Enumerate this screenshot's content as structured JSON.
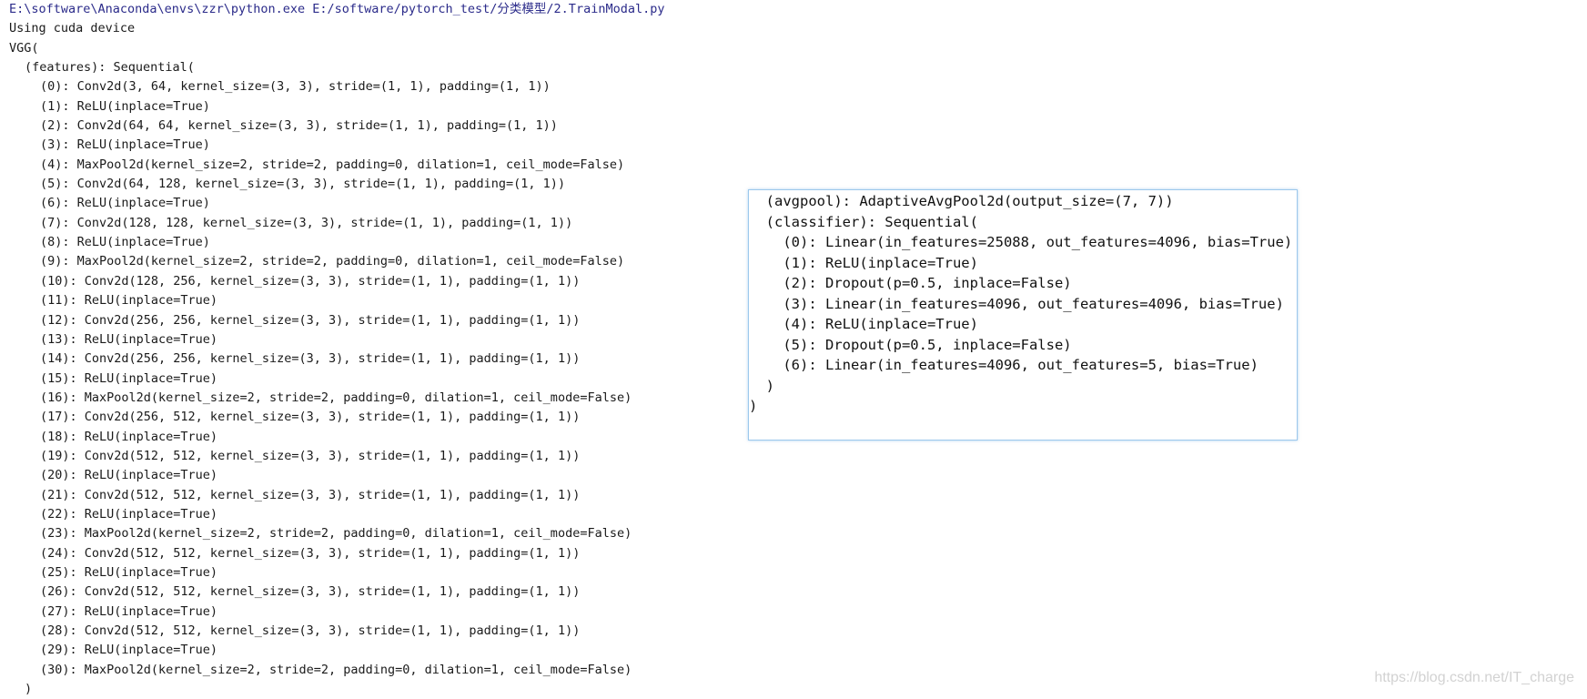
{
  "console": {
    "command": "E:\\software\\Anaconda\\envs\\zzr\\python.exe E:/software/pytorch_test/分类模型/2.TrainModal.py",
    "device_line": "Using cuda device",
    "model_open": "VGG(",
    "features_header": "(features): Sequential(",
    "layers": [
      "(0): Conv2d(3, 64, kernel_size=(3, 3), stride=(1, 1), padding=(1, 1))",
      "(1): ReLU(inplace=True)",
      "(2): Conv2d(64, 64, kernel_size=(3, 3), stride=(1, 1), padding=(1, 1))",
      "(3): ReLU(inplace=True)",
      "(4): MaxPool2d(kernel_size=2, stride=2, padding=0, dilation=1, ceil_mode=False)",
      "(5): Conv2d(64, 128, kernel_size=(3, 3), stride=(1, 1), padding=(1, 1))",
      "(6): ReLU(inplace=True)",
      "(7): Conv2d(128, 128, kernel_size=(3, 3), stride=(1, 1), padding=(1, 1))",
      "(8): ReLU(inplace=True)",
      "(9): MaxPool2d(kernel_size=2, stride=2, padding=0, dilation=1, ceil_mode=False)",
      "(10): Conv2d(128, 256, kernel_size=(3, 3), stride=(1, 1), padding=(1, 1))",
      "(11): ReLU(inplace=True)",
      "(12): Conv2d(256, 256, kernel_size=(3, 3), stride=(1, 1), padding=(1, 1))",
      "(13): ReLU(inplace=True)",
      "(14): Conv2d(256, 256, kernel_size=(3, 3), stride=(1, 1), padding=(1, 1))",
      "(15): ReLU(inplace=True)",
      "(16): MaxPool2d(kernel_size=2, stride=2, padding=0, dilation=1, ceil_mode=False)",
      "(17): Conv2d(256, 512, kernel_size=(3, 3), stride=(1, 1), padding=(1, 1))",
      "(18): ReLU(inplace=True)",
      "(19): Conv2d(512, 512, kernel_size=(3, 3), stride=(1, 1), padding=(1, 1))",
      "(20): ReLU(inplace=True)",
      "(21): Conv2d(512, 512, kernel_size=(3, 3), stride=(1, 1), padding=(1, 1))",
      "(22): ReLU(inplace=True)",
      "(23): MaxPool2d(kernel_size=2, stride=2, padding=0, dilation=1, ceil_mode=False)",
      "(24): Conv2d(512, 512, kernel_size=(3, 3), stride=(1, 1), padding=(1, 1))",
      "(25): ReLU(inplace=True)",
      "(26): Conv2d(512, 512, kernel_size=(3, 3), stride=(1, 1), padding=(1, 1))",
      "(27): ReLU(inplace=True)",
      "(28): Conv2d(512, 512, kernel_size=(3, 3), stride=(1, 1), padding=(1, 1))",
      "(29): ReLU(inplace=True)",
      "(30): MaxPool2d(kernel_size=2, stride=2, padding=0, dilation=1, ceil_mode=False)"
    ],
    "features_close": ")"
  },
  "popup": {
    "lines": [
      "  (avgpool): AdaptiveAvgPool2d(output_size=(7, 7))",
      "  (classifier): Sequential(",
      "    (0): Linear(in_features=25088, out_features=4096, bias=True)",
      "    (1): ReLU(inplace=True)",
      "    (2): Dropout(p=0.5, inplace=False)",
      "    (3): Linear(in_features=4096, out_features=4096, bias=True)",
      "    (4): ReLU(inplace=True)",
      "    (5): Dropout(p=0.5, inplace=False)",
      "    (6): Linear(in_features=4096, out_features=5, bias=True)",
      "  )",
      ")"
    ]
  },
  "watermark": "https://blog.csdn.net/IT_charge",
  "colors": {
    "command_text": "#2b2b8a",
    "output_text": "#1a1a1a",
    "popup_border": "#9cc8ec"
  }
}
